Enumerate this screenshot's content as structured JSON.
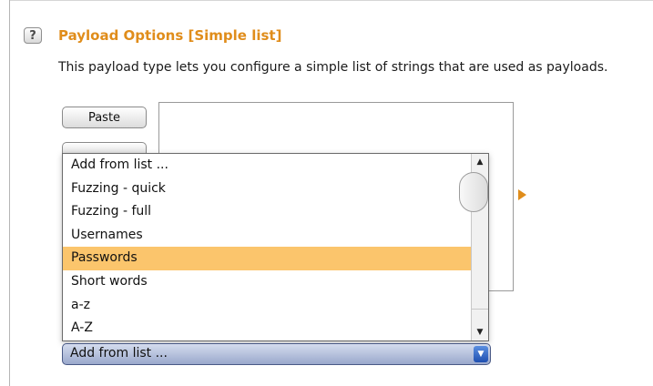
{
  "header": {
    "help_glyph": "?",
    "title": "Payload Options [Simple list]",
    "description": "This payload type lets you configure a simple list of strings that are used as payloads."
  },
  "buttons": {
    "paste": "Paste"
  },
  "dropdown": {
    "items": [
      "Add from list ...",
      "Fuzzing - quick",
      "Fuzzing - full",
      "Usernames",
      "Passwords",
      "Short words",
      "a-z",
      "A-Z"
    ],
    "selected_index": 4,
    "selected_value": "Add from list ..."
  },
  "icons": {
    "help": "help-icon",
    "scroll_up": "scroll-up-arrow-icon",
    "scroll_down": "scroll-down-arrow-icon",
    "select_arrow": "dropdown-arrow-icon",
    "add_arrow": "arrow-right-icon"
  },
  "colors": {
    "title": "#e08d1b",
    "selected_row": "#fbc56c",
    "select_box": "#9aa8cc",
    "select_arrow": "#1f4fb0"
  }
}
